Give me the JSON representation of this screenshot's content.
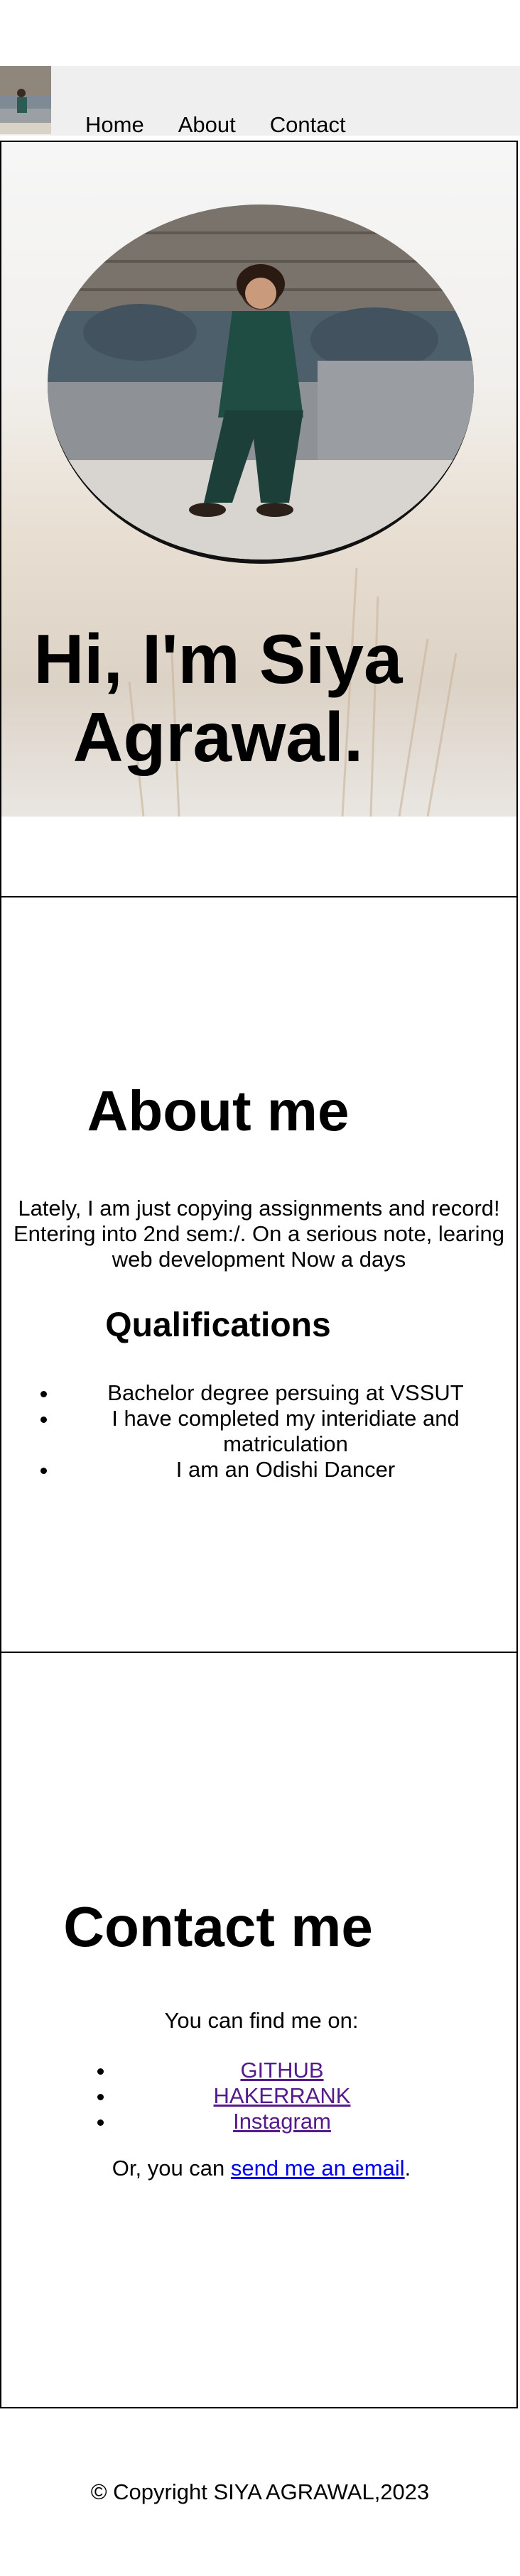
{
  "nav": {
    "items": [
      "Home",
      "About",
      "Contact"
    ]
  },
  "hero": {
    "title_line1": "Hi, I'm Siya",
    "title_line2": "Agrawal."
  },
  "about": {
    "title": "About me",
    "text": "Lately, I am just copying assignments and record! Entering into 2nd sem:/. On a serious note, learing web development Now a days",
    "qualifications_title": "Qualifications",
    "qualifications": [
      "Bachelor degree persuing at VSSUT",
      "I have completed my interidiate and matriculation",
      "I am an Odishi Dancer"
    ]
  },
  "contact": {
    "title": "Contact me",
    "find_text": "You can find me on:",
    "links": [
      "GITHUB",
      "HAKERRANK",
      "Instagram"
    ],
    "email_prefix": "Or, you can ",
    "email_link": "send me an email",
    "email_suffix": "."
  },
  "footer": {
    "text": "© Copyright SIYA AGRAWAL,2023"
  },
  "colors": {
    "header_bg": "#efefef",
    "visited_link": "#551a8b",
    "link": "#0000ee",
    "border": "#000000"
  }
}
